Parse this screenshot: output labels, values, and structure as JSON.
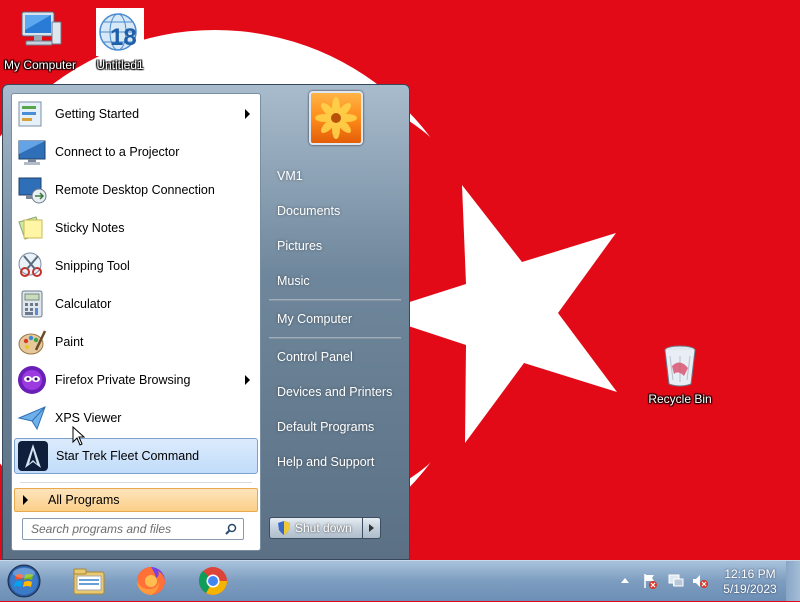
{
  "desktop": {
    "icons": [
      {
        "label": "My Computer",
        "icon": "computer-icon"
      },
      {
        "label": "Untitled1",
        "icon": "globe-18-icon",
        "badge": "18"
      },
      {
        "label": "Recycle Bin",
        "icon": "recycle-bin-icon"
      }
    ]
  },
  "start_menu": {
    "programs": [
      {
        "label": "Getting Started",
        "icon": "getting-started-icon",
        "submenu": true
      },
      {
        "label": "Connect to a Projector",
        "icon": "projector-icon",
        "submenu": false
      },
      {
        "label": "Remote Desktop Connection",
        "icon": "remote-desktop-icon",
        "submenu": false
      },
      {
        "label": "Sticky Notes",
        "icon": "sticky-notes-icon",
        "submenu": false
      },
      {
        "label": "Snipping Tool",
        "icon": "scissors-icon",
        "submenu": false
      },
      {
        "label": "Calculator",
        "icon": "calculator-icon",
        "submenu": false
      },
      {
        "label": "Paint",
        "icon": "paint-palette-icon",
        "submenu": false
      },
      {
        "label": "Firefox Private Browsing",
        "icon": "firefox-private-icon",
        "submenu": true
      },
      {
        "label": "XPS Viewer",
        "icon": "xps-viewer-icon",
        "submenu": false
      },
      {
        "label": "Star Trek Fleet Command",
        "icon": "star-trek-icon",
        "submenu": false,
        "selected": true
      }
    ],
    "all_programs": "All Programs",
    "search_placeholder": "Search programs and files",
    "right_items": [
      {
        "label": "VM1"
      },
      {
        "label": "Documents"
      },
      {
        "label": "Pictures"
      },
      {
        "label": "Music"
      },
      {
        "label": "My Computer"
      },
      {
        "label": "Control Panel"
      },
      {
        "label": "Devices and Printers"
      },
      {
        "label": "Default Programs"
      },
      {
        "label": "Help and Support"
      }
    ],
    "shutdown_label": "Shut down"
  },
  "taskbar": {
    "pinned": [
      {
        "name": "windows-explorer-icon"
      },
      {
        "name": "firefox-icon"
      },
      {
        "name": "chrome-icon"
      }
    ],
    "time": "12:16 PM",
    "date": "5/19/2023"
  },
  "colors": {
    "wallpaper_red": "#e30a17",
    "wallpaper_white": "#ffffff",
    "selected_highlight": "#c1dcfa",
    "all_programs_bg": "#fbcf88"
  }
}
